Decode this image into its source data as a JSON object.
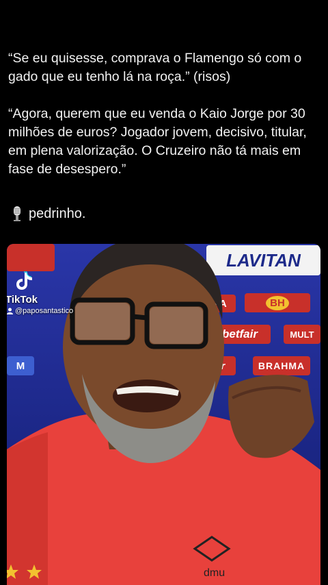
{
  "post": {
    "paragraph_1": "“Se eu quisesse, comprava o Flamengo só com o gado que eu tenho lá na roça.” (risos)",
    "paragraph_2": "“Agora, querem que eu venda o Kaio Jorge por 30 milhões de euros? Jogador jovem, decisivo, titular, em plena valorização. O Cruzeiro não tá mais em fase de desespero.”",
    "signature_icon": "microphone-icon",
    "signature": "pedrinho."
  },
  "video": {
    "watermark_brand": "TikTok",
    "watermark_handle": "@paposantastico",
    "sponsors": {
      "lavitan": "LAVITAN",
      "ma": "MA",
      "bh": "BH",
      "betfair": "betfair",
      "multi": "MULT",
      "air": "air",
      "brahma": "BRAHMA",
      "m": "M"
    },
    "shirt_brand": "dmu",
    "colors": {
      "backdrop": "#1d2a8a",
      "shirt": "#e8413c",
      "sponsor_red": "#c8302a"
    }
  }
}
